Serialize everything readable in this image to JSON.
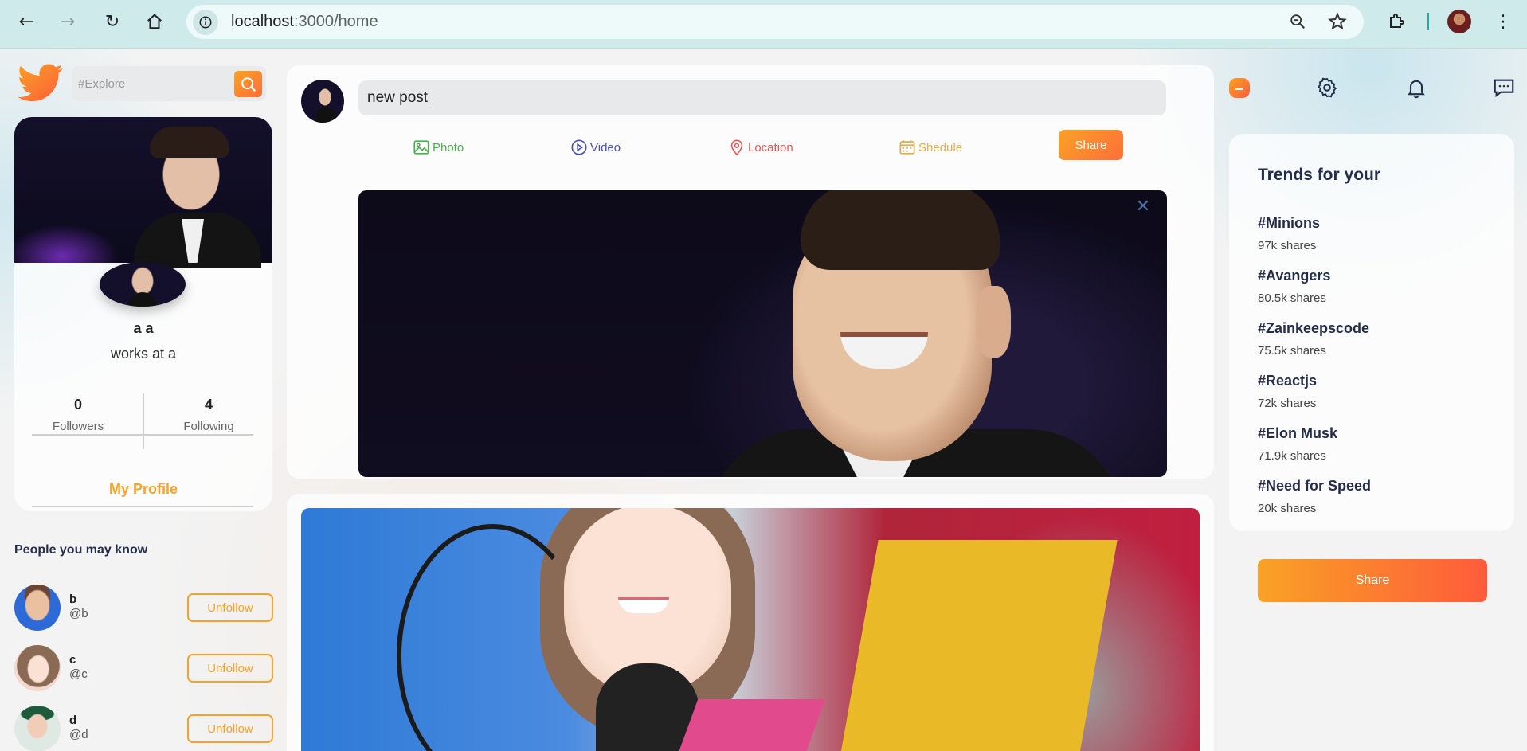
{
  "browser": {
    "url_host": "localhost",
    "url_rest": ":3000/home"
  },
  "search": {
    "placeholder": "#Explore"
  },
  "profile": {
    "name": "a a",
    "work": "works at a",
    "followers_count": "0",
    "followers_label": "Followers",
    "following_count": "4",
    "following_label": "Following",
    "my_profile_label": "My Profile"
  },
  "people": {
    "title": "People you may know",
    "items": [
      {
        "name": "b",
        "handle": "@b",
        "button": "Unfollow"
      },
      {
        "name": "c",
        "handle": "@c",
        "button": "Unfollow"
      },
      {
        "name": "d",
        "handle": "@d",
        "button": "Unfollow"
      }
    ]
  },
  "post_share": {
    "input_value": "new post",
    "options": {
      "photo": "Photo",
      "video": "Video",
      "location": "Location",
      "schedule": "Shedule"
    },
    "share_label": "Share"
  },
  "trends": {
    "title": "Trends for your",
    "items": [
      {
        "tag": "#Minions",
        "shares": "97k shares"
      },
      {
        "tag": "#Avangers",
        "shares": "80.5k shares"
      },
      {
        "tag": "#Zainkeepscode",
        "shares": "75.5k shares"
      },
      {
        "tag": "#Reactjs",
        "shares": "72k shares"
      },
      {
        "tag": "#Elon Musk",
        "shares": "71.9k shares"
      },
      {
        "tag": "#Need for Speed",
        "shares": "20k shares"
      }
    ],
    "share_label": "Share"
  },
  "colors": {
    "accent_orange": "#f9a225",
    "accent_red": "#fe6e3a",
    "photo_green": "#4caf50",
    "video_purple": "#4a4eb7",
    "location_red": "#ef5757",
    "schedule_yellow": "#e1ae4a"
  }
}
